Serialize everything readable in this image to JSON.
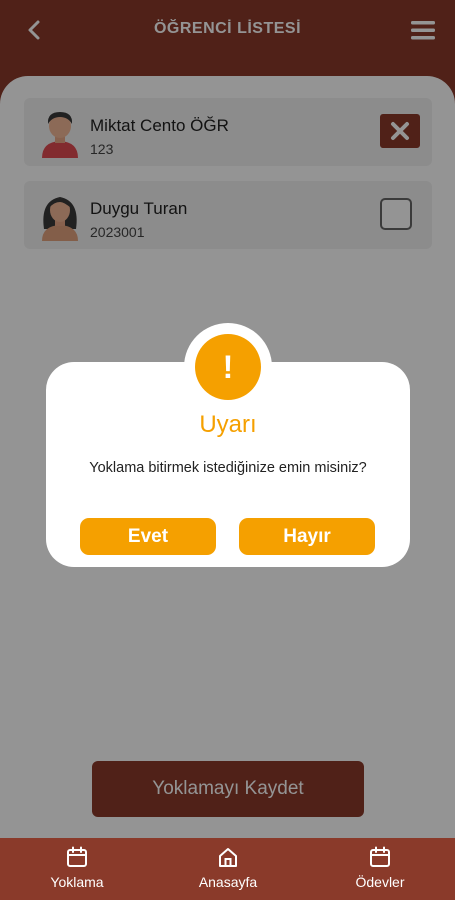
{
  "header": {
    "title": "ÖĞRENCİ LİSTESİ"
  },
  "students": [
    {
      "name": "Miktat Cento ÖĞR",
      "number": "123",
      "checked": true
    },
    {
      "name": "Duygu Turan",
      "number": "2023001",
      "checked": false
    }
  ],
  "actions": {
    "save_label": "Yoklamayı Kaydet"
  },
  "dialog": {
    "title": "Uyarı",
    "icon": "!",
    "message": "Yoklama bitirmek istediğinize emin misiniz?",
    "yes_label": "Evet",
    "no_label": "Hayır"
  },
  "bottom_nav": [
    {
      "label": "Yoklama",
      "icon": "calendar-icon"
    },
    {
      "label": "Anasayfa",
      "icon": "home-icon"
    },
    {
      "label": "Ödevler",
      "icon": "calendar-icon"
    }
  ],
  "colors": {
    "brand": "#8a3a2a",
    "accent": "#f5a000"
  }
}
